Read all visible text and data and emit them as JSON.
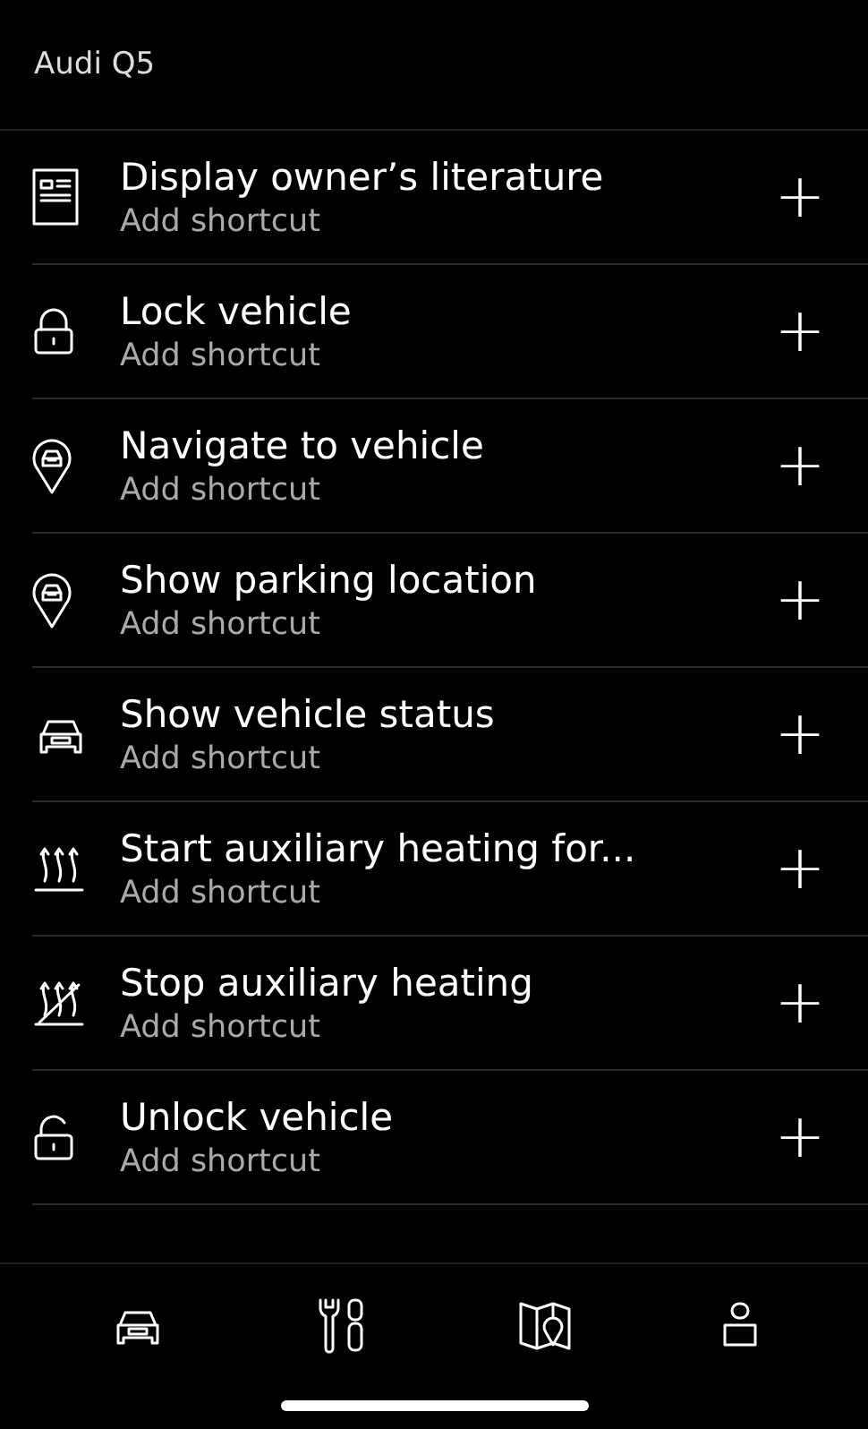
{
  "header": {
    "title": "Audi Q5"
  },
  "actions": [
    {
      "kind": "document",
      "title": "Display owner’s literature",
      "subtitle": "Add shortcut",
      "button": "+"
    },
    {
      "kind": "lock",
      "title": "Lock vehicle",
      "subtitle": "Add shortcut",
      "button": "+"
    },
    {
      "kind": "pin",
      "title": "Navigate to vehicle",
      "subtitle": "Add shortcut",
      "button": "+"
    },
    {
      "kind": "pin",
      "title": "Show parking location",
      "subtitle": "Add shortcut",
      "button": "+"
    },
    {
      "kind": "car",
      "title": "Show vehicle status",
      "subtitle": "Add shortcut",
      "button": "+"
    },
    {
      "kind": "heat",
      "title": "Start auxiliary heating for...",
      "subtitle": "Add shortcut",
      "button": "+"
    },
    {
      "kind": "heatoff",
      "title": "Stop auxiliary heating",
      "subtitle": "Add shortcut",
      "button": "+"
    },
    {
      "kind": "unlock",
      "title": "Unlock vehicle",
      "subtitle": "Add shortcut",
      "button": "+"
    }
  ],
  "tab_bar": [
    {
      "kind": "car"
    },
    {
      "kind": "tools"
    },
    {
      "kind": "map"
    },
    {
      "kind": "person"
    }
  ]
}
